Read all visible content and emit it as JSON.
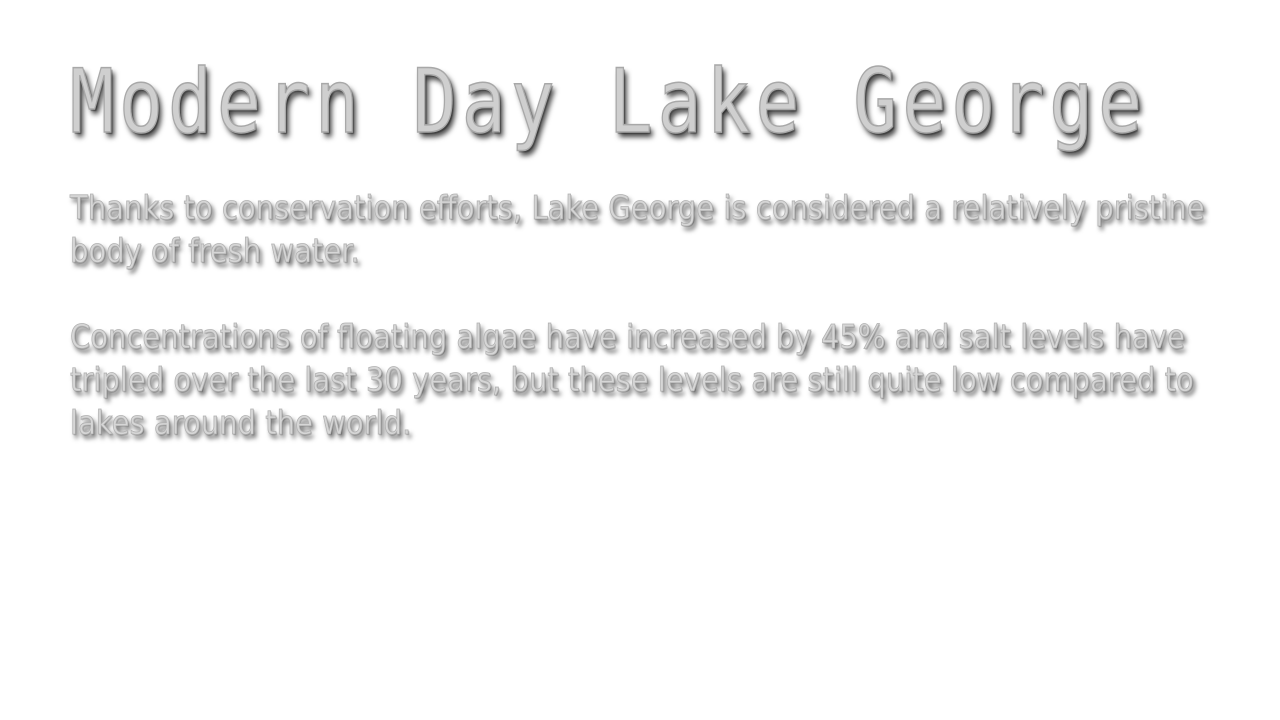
{
  "slide": {
    "title": "Modern Day Lake George",
    "paragraphs": [
      "Thanks to conservation efforts, Lake George is considered a relatively pristine body of fresh water.",
      "Concentrations of floating algae have increased by 45% and salt levels have tripled over the last 30 years, but these levels are still quite low compared to lakes around the world."
    ]
  },
  "colors": {
    "background": "#ffffff",
    "text": "#d0d0d0",
    "shadow": "#000000"
  }
}
